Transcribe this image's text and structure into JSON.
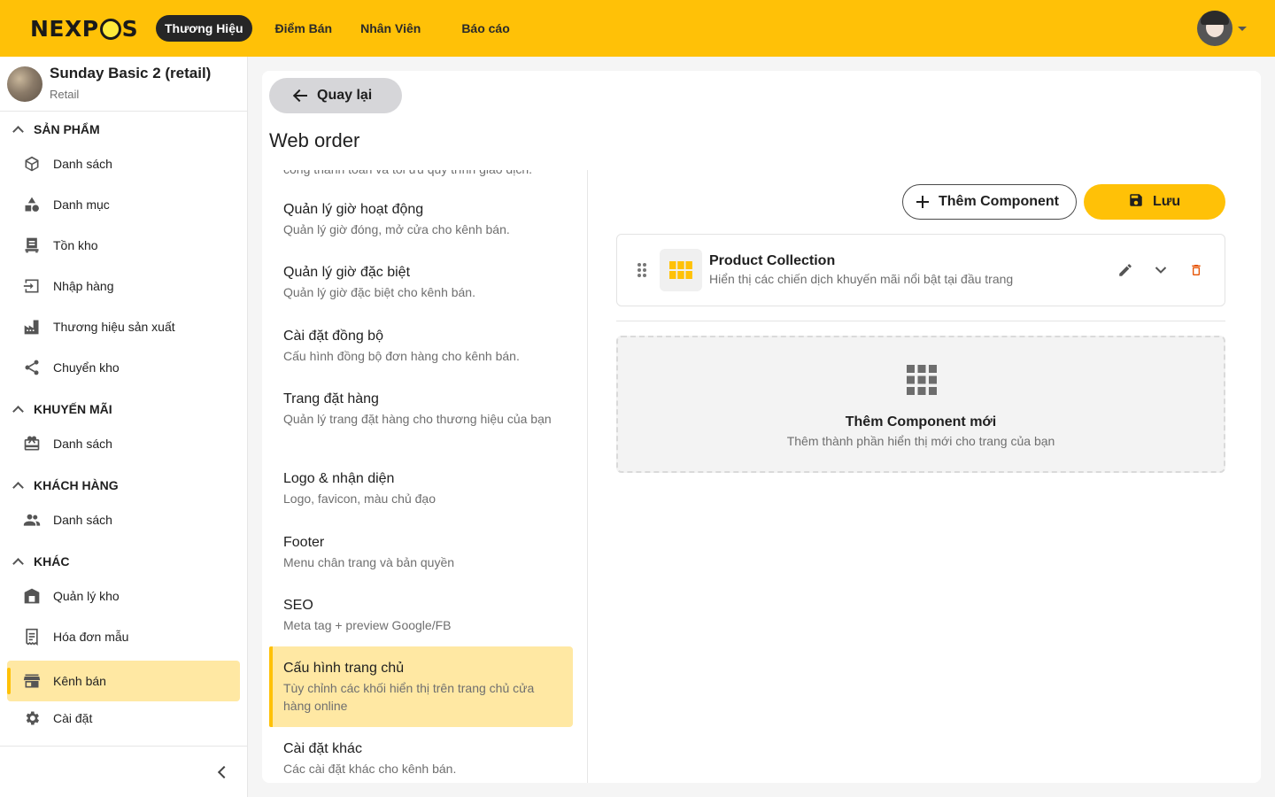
{
  "app": {
    "logo_left": "NEX",
    "logo_right": "P",
    "logo_end": "S"
  },
  "nav": {
    "items": [
      {
        "label": "Thương Hiệu"
      },
      {
        "label": "Điểm Bán"
      },
      {
        "label": "Nhân Viên"
      },
      {
        "label": "Báo cáo"
      }
    ]
  },
  "store": {
    "name": "Sunday Basic 2 (retail)",
    "type": "Retail"
  },
  "sidebar": {
    "sections": [
      {
        "label": "SẢN PHẨM"
      },
      {
        "label": "KHUYẾN MÃI"
      },
      {
        "label": "KHÁCH HÀNG"
      },
      {
        "label": "KHÁC"
      }
    ],
    "items": [
      {
        "label": "Danh sách",
        "icon": "cube-icon"
      },
      {
        "label": "Danh mục",
        "icon": "shapes-icon"
      },
      {
        "label": "Tồn kho",
        "icon": "inventory-icon"
      },
      {
        "label": "Nhập hàng",
        "icon": "import-icon"
      },
      {
        "label": "Thương hiệu sản xuất",
        "icon": "factory-icon"
      },
      {
        "label": "Chuyển kho",
        "icon": "share-icon"
      },
      {
        "label": "Danh sách",
        "icon": "gift-card-icon"
      },
      {
        "label": "Danh sách",
        "icon": "people-icon"
      },
      {
        "label": "Quản lý kho",
        "icon": "warehouse-icon"
      },
      {
        "label": "Hóa đơn mẫu",
        "icon": "receipt-icon"
      },
      {
        "label": "Kênh bán",
        "icon": "store-icon"
      },
      {
        "label": "Cài đặt",
        "icon": "gear-icon"
      }
    ]
  },
  "main": {
    "back_label": "Quay lại",
    "title": "Web order",
    "cut_text": "cổng thanh toán và tối ưu quy trình giao dịch.",
    "settings": [
      {
        "title": "Quản lý giờ hoạt động",
        "desc": "Quản lý giờ đóng, mở cửa cho kênh bán."
      },
      {
        "title": "Quản lý giờ đặc biệt",
        "desc": "Quản lý giờ đặc biệt cho kênh bán."
      },
      {
        "title": "Cài đặt đồng bộ",
        "desc": "Cấu hình đồng bộ đơn hàng cho kênh bán."
      },
      {
        "title": "Trang đặt hàng",
        "desc": "Quản lý trang đặt hàng cho thương hiệu của bạn"
      },
      {
        "title": "Logo & nhận diện",
        "desc": "Logo, favicon, màu chủ đạo"
      },
      {
        "title": "Footer",
        "desc": "Menu chân trang và bản quyền"
      },
      {
        "title": "SEO",
        "desc": "Meta tag + preview Google/FB"
      },
      {
        "title": "Cấu hình trang chủ",
        "desc": "Tùy chỉnh các khối hiển thị trên trang chủ cửa hàng online"
      },
      {
        "title": "Cài đặt khác",
        "desc": "Các cài đặt khác cho kênh bán."
      }
    ],
    "add_component_label": "Thêm Component",
    "save_label": "Lưu",
    "component": {
      "name": "Product Collection",
      "desc": "Hiển thị các chiến dịch khuyến mãi nổi bật tại đầu trang"
    },
    "dropzone": {
      "title": "Thêm Component mới",
      "desc": "Thêm thành phần hiển thị mới cho trang của bạn"
    }
  },
  "colors": {
    "brand": "#ffc107",
    "active_bg": "#ffe8a3",
    "danger": "#e65100"
  }
}
